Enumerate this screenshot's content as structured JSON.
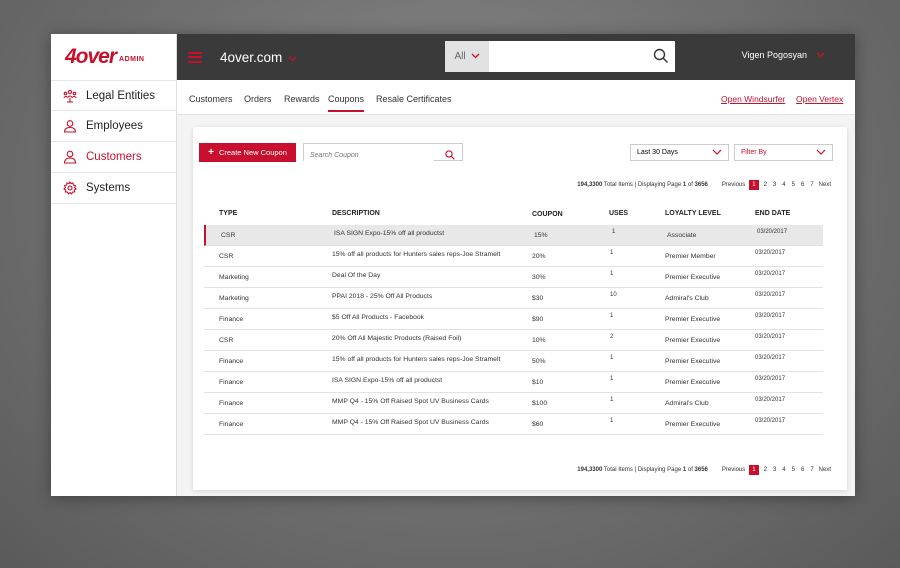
{
  "logo": {
    "main": "4over",
    "sub": "ADMIN"
  },
  "sidebar": {
    "items": [
      {
        "label": "Legal Entities",
        "icon": "legal-entities-icon"
      },
      {
        "label": "Employees",
        "icon": "user-icon"
      },
      {
        "label": "Customers",
        "icon": "customer-icon"
      },
      {
        "label": "Systems",
        "icon": "gear-icon"
      }
    ]
  },
  "header": {
    "brand": "4over.com",
    "search_scope": "All",
    "search_placeholder": "",
    "user": "Vigen Pogosyan"
  },
  "subnav": {
    "tabs": [
      "Customers",
      "Orders",
      "Rewards",
      "Coupons",
      "Resale Certificates"
    ],
    "links": [
      "Open Windsurfer",
      "Open Vertex"
    ]
  },
  "toolbar": {
    "create_label": "Create New  Coupon",
    "search_placeholder": "Search Coupon",
    "date_filter": "Last 30 Days",
    "filter_by": "Filter By"
  },
  "pager": {
    "info_count": "194,3300",
    "info_total": " Total Items",
    "info_sep": "|",
    "info_display": "Displaying Page",
    "info_page": "1",
    "info_of": "of",
    "info_pages": "3656",
    "previous": "Previous",
    "pages": [
      "1",
      "2",
      "3",
      "4",
      "5",
      "6",
      "7"
    ],
    "next": "Next"
  },
  "table": {
    "headers": [
      "TYPE",
      "DESCRIPTION",
      "COUPON",
      "USES",
      "LOYALTY LEVEL",
      "END DATE"
    ],
    "rows": [
      {
        "type": "CSR",
        "description": "ISA SIGN Expo-15% off all productst",
        "coupon": "15%",
        "uses": "1",
        "loyalty": "Associate",
        "end": "03/20/2017"
      },
      {
        "type": "CSR",
        "description": "15% off all products for Hunters sales reps-Joe Stramelt",
        "coupon": "20%",
        "uses": "1",
        "loyalty": "Premier Member",
        "end": "03/20/2017"
      },
      {
        "type": "Marketing",
        "description": "Deal Of the Day",
        "coupon": "30%",
        "uses": "1",
        "loyalty": "Premier Executive",
        "end": "03/20/2017"
      },
      {
        "type": "Marketing",
        "description": "PPAI 2018 - 25% Off All Products",
        "coupon": "$30",
        "uses": "10",
        "loyalty": "Admiral's Club",
        "end": "03/20/2017"
      },
      {
        "type": "Finance",
        "description": "$5 Off All Products - Facebook",
        "coupon": "$90",
        "uses": "1",
        "loyalty": "Premier Executive",
        "end": "03/20/2017"
      },
      {
        "type": "CSR",
        "description": "20% Off All Majestic Products (Raised Foil)",
        "coupon": "10%",
        "uses": "2",
        "loyalty": "Premier Executive",
        "end": "03/20/2017"
      },
      {
        "type": "Finance",
        "description": "15% off all products for Hunters sales reps-Joe Stramelt",
        "coupon": "50%",
        "uses": "1",
        "loyalty": "Premier Executive",
        "end": "03/20/2017"
      },
      {
        "type": "Finance",
        "description": "ISA SIGN Expo-15% off all productst",
        "coupon": "$10",
        "uses": "1",
        "loyalty": "Premier Executive",
        "end": "03/20/2017"
      },
      {
        "type": "Finance",
        "description": "MMP Q4 - 15% Off Raised Spot UV Business Cards",
        "coupon": "$100",
        "uses": "1",
        "loyalty": "Admiral's Club",
        "end": "03/20/2017"
      },
      {
        "type": "Finance",
        "description": "MMP Q4 - 15% Off Raised Spot UV Business Cards",
        "coupon": "$60",
        "uses": "1",
        "loyalty": "Premier Executive",
        "end": "03/20/2017"
      }
    ]
  },
  "colors": {
    "accent": "#c8102e",
    "header_bg": "#3a3a3a",
    "page_bg": "#f4f4f4"
  }
}
